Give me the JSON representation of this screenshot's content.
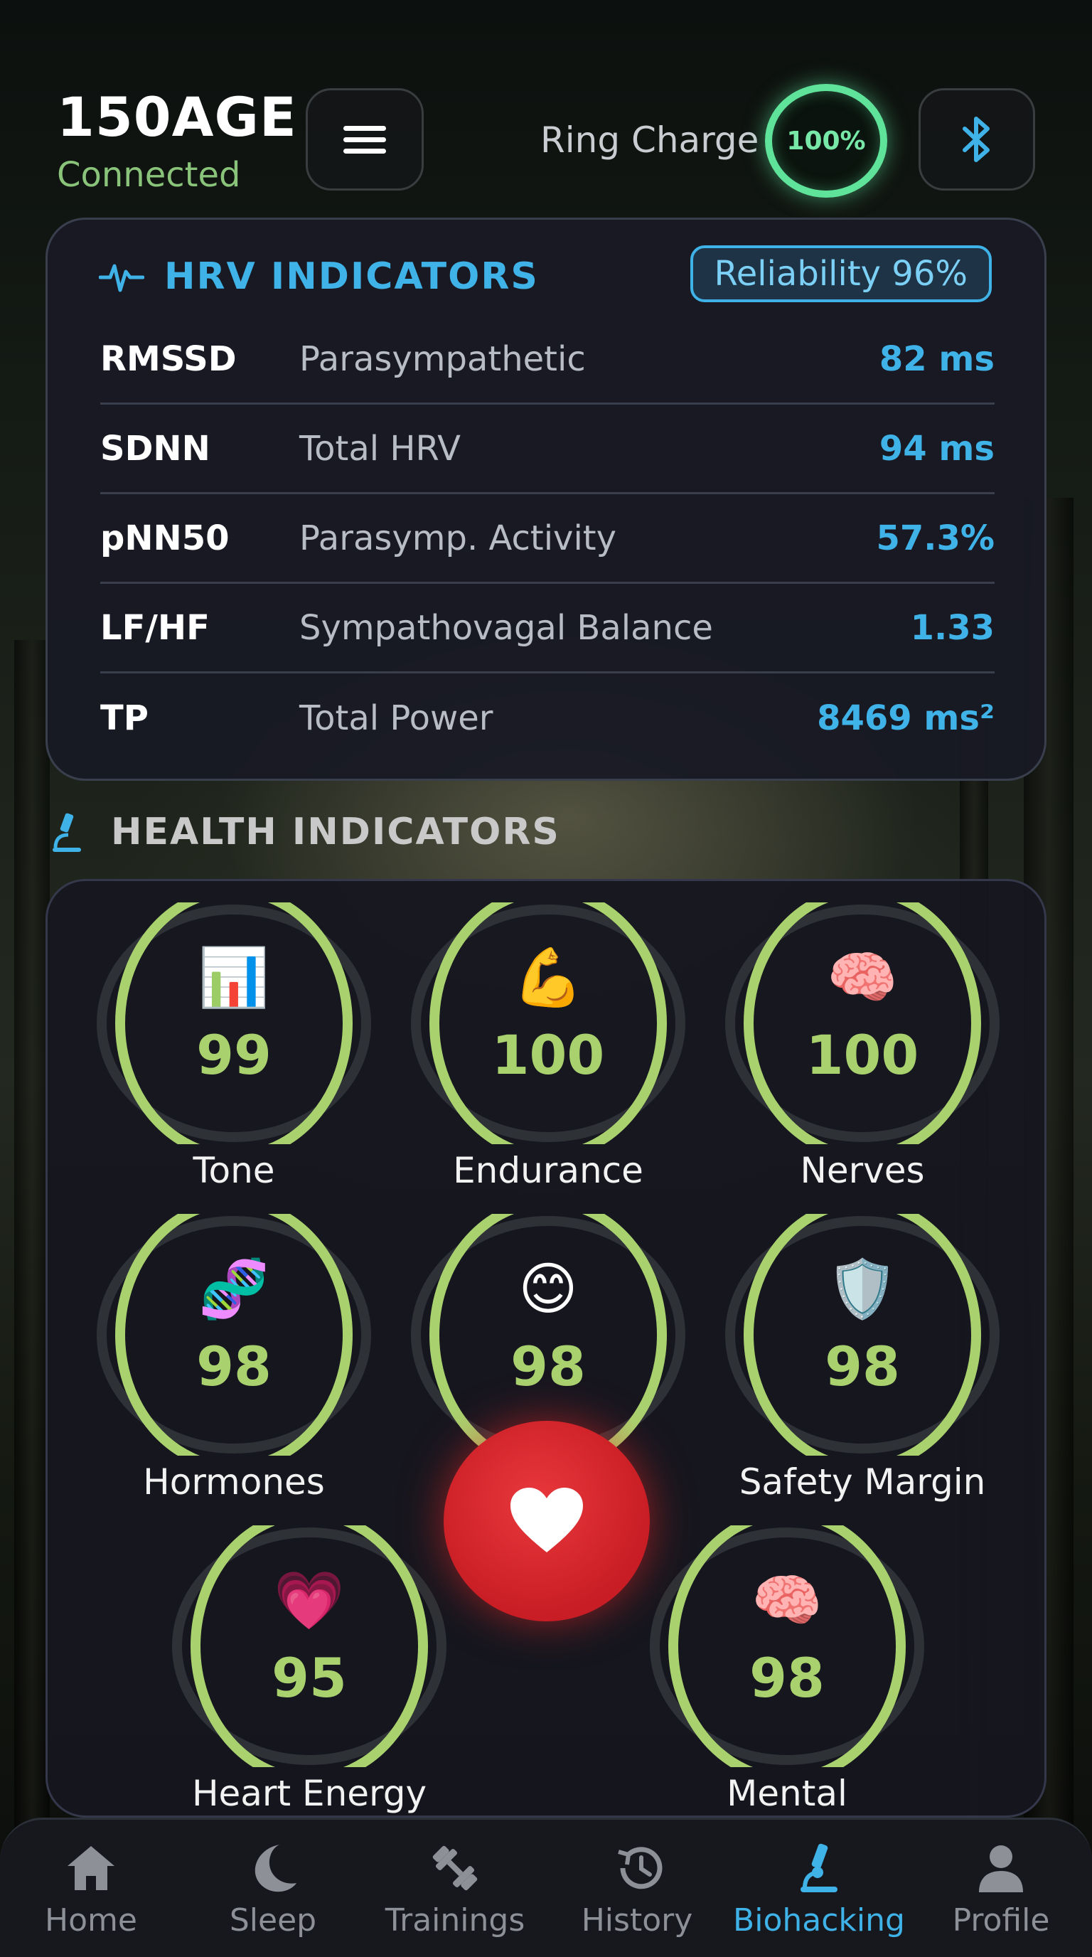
{
  "header": {
    "app_title": "150AGE",
    "status": "Connected",
    "ring_label": "Ring Charge",
    "ring_charge": "100%",
    "menu_icon": "hamburger-icon",
    "bluetooth_icon": "bluetooth-icon"
  },
  "hrv": {
    "title": "HRV INDICATORS",
    "reliability": "Reliability 96%",
    "rows": [
      {
        "key": "RMSSD",
        "desc": "Parasympathetic",
        "value": "82 ms"
      },
      {
        "key": "SDNN",
        "desc": "Total HRV",
        "value": "94 ms"
      },
      {
        "key": "pNN50",
        "desc": "Parasymp. Activity",
        "value": "57.3%"
      },
      {
        "key": "LF/HF",
        "desc": "Sympathovagal Balance",
        "value": "1.33"
      },
      {
        "key": "TP",
        "desc": "Total Power",
        "value": "8469 ms²"
      }
    ]
  },
  "health": {
    "title": "HEALTH INDICATORS",
    "gauges": [
      {
        "label": "Tone",
        "value": "99",
        "icon": "📊",
        "fraction": 0.99
      },
      {
        "label": "Endurance",
        "value": "100",
        "icon": "💪",
        "fraction": 1.0
      },
      {
        "label": "Nerves",
        "value": "100",
        "icon": "🧠",
        "fraction": 1.0
      },
      {
        "label": "Hormones",
        "value": "98",
        "icon": "🧬",
        "fraction": 0.98
      },
      {
        "label": "",
        "value": "98",
        "icon": "😊",
        "fraction": 0.98
      },
      {
        "label": "Safety Margin",
        "value": "98",
        "icon": "🛡️",
        "fraction": 0.98
      },
      {
        "label": "Heart Energy",
        "value": "95",
        "icon": "💗",
        "fraction": 0.95
      },
      {
        "label": "Mental",
        "value": "98",
        "icon": "🧠",
        "fraction": 0.98
      }
    ],
    "ring_color": "#a9d26f"
  },
  "nav": {
    "items": [
      {
        "label": "Home",
        "icon": "home-icon"
      },
      {
        "label": "Sleep",
        "icon": "moon-icon"
      },
      {
        "label": "Trainings",
        "icon": "dumbbell-icon"
      },
      {
        "label": "History",
        "icon": "history-icon"
      },
      {
        "label": "Biohacking",
        "icon": "microscope-icon",
        "active": true
      },
      {
        "label": "Profile",
        "icon": "person-icon"
      }
    ]
  },
  "colors": {
    "accent": "#3fb2e8",
    "charge": "#5fe39a",
    "gauge": "#a9d26f",
    "heart": "#d62a30"
  }
}
